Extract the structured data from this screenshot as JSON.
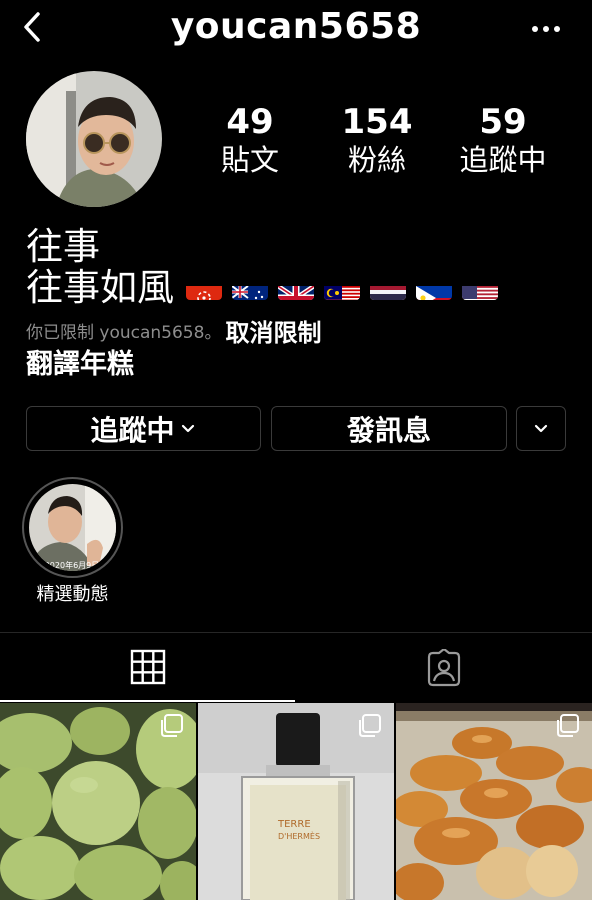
{
  "header": {
    "username": "youcan5658"
  },
  "stats": [
    {
      "count": "49",
      "label": "貼文"
    },
    {
      "count": "154",
      "label": "粉絲"
    },
    {
      "count": "59",
      "label": "追蹤中"
    }
  ],
  "bio": {
    "name": "往事",
    "line": "往事如風",
    "flags": [
      "hong-kong-flag",
      "australia-flag",
      "uk-flag",
      "malaysia-flag",
      "thailand-flag",
      "philippines-flag",
      "usa-flag"
    ],
    "restricted_text": "你已限制 youcan5658。",
    "unrestrict_label": "取消限制",
    "translate_label": "翻譯年糕"
  },
  "actions": {
    "following_label": "追蹤中",
    "message_label": "發訊息"
  },
  "highlights": [
    {
      "label": "精選動態",
      "cover_text": "2020年6月9日"
    }
  ],
  "tabs": [
    {
      "icon": "grid-icon",
      "active": true
    },
    {
      "icon": "tagged-icon",
      "active": false
    }
  ],
  "posts": [
    {
      "subject": "guavas"
    },
    {
      "subject": "perfume",
      "bottle_text_1": "TERRE",
      "bottle_text_2": "D'HERMÈS"
    },
    {
      "subject": "bread-rolls"
    }
  ]
}
